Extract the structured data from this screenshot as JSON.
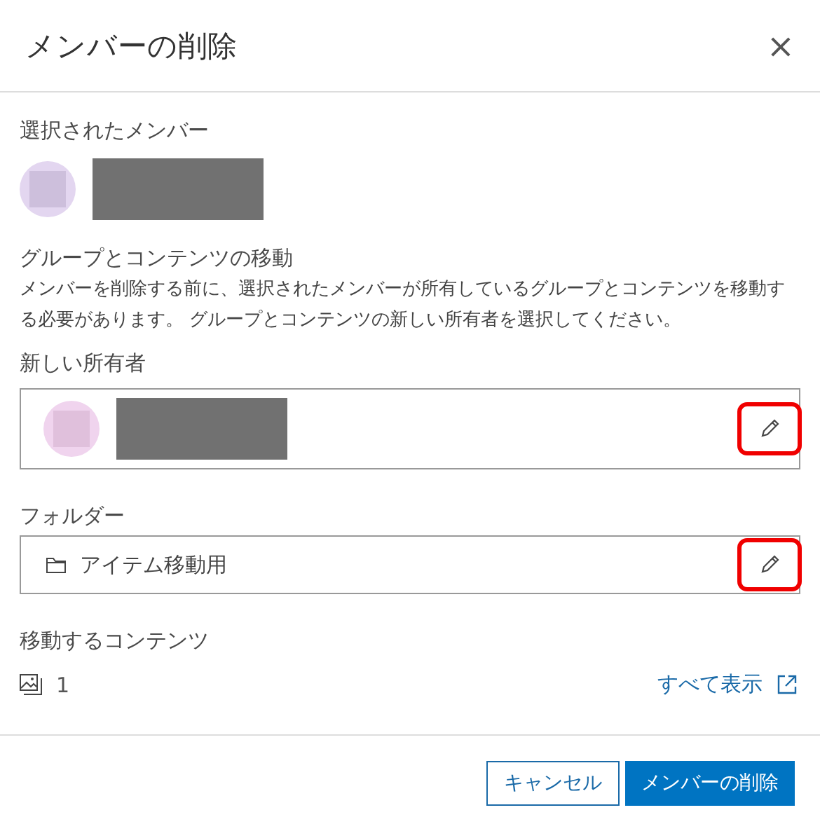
{
  "dialog": {
    "title": "メンバーの削除",
    "close": "×"
  },
  "selected_members": {
    "label": "選択されたメンバー",
    "members": [
      {
        "redacted": true
      }
    ]
  },
  "transfer": {
    "heading": "グループとコンテンツの移動",
    "description": "メンバーを削除する前に、選択されたメンバーが所有しているグループとコンテンツを移動する必要があります。 グループとコンテンツの新しい所有者を選択してください。"
  },
  "new_owner": {
    "label": "新しい所有者",
    "redacted": true,
    "edit_highlighted": true
  },
  "folder": {
    "label": "フォルダー",
    "value": "アイテム移動用",
    "edit_highlighted": true
  },
  "content": {
    "label": "移動するコンテンツ",
    "count": "1",
    "link": "すべて表示"
  },
  "buttons": [
    {
      "label": "キャンセル",
      "kind": "secondary"
    },
    {
      "label": "メンバーの削除",
      "kind": "primary"
    }
  ]
}
